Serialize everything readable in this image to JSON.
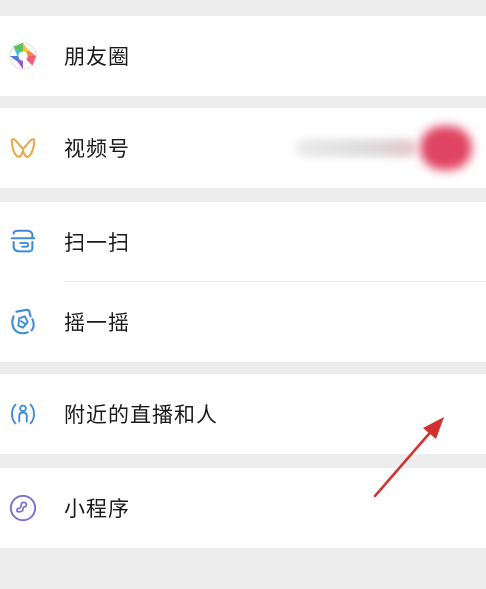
{
  "menu": {
    "moments": {
      "label": "朋友圈",
      "icon": "moments-aperture-icon"
    },
    "channels": {
      "label": "视频号",
      "icon": "channels-butterfly-icon",
      "badge_color": "#e04462"
    },
    "scan": {
      "label": "扫一扫",
      "icon": "scan-icon"
    },
    "shake": {
      "label": "摇一摇",
      "icon": "shake-icon"
    },
    "nearby": {
      "label": "附近的直播和人",
      "icon": "nearby-person-icon"
    },
    "mini_programs": {
      "label": "小程序",
      "icon": "mini-program-icon"
    }
  },
  "colors": {
    "background": "#ededed",
    "accent_blue": "#3d8bd6",
    "annotation_arrow": "#d32f2f"
  }
}
